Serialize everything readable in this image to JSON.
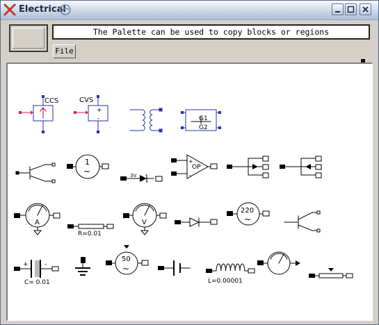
{
  "window": {
    "title": "Electrical"
  },
  "header": {
    "message": "The Palette can be used to copy blocks or regions",
    "file_label": "File"
  },
  "palette": {
    "ccs_label": "CCS",
    "cvs_label": "CVS",
    "cvs_plus": "+",
    "cvs_minus": "-",
    "gyrator_g1": "G1",
    "gyrator_g2": "G2",
    "sine_source_1": "1",
    "sine_symbol": "~",
    "zener_label": "3V",
    "opamp_label": "OP",
    "ammeter_label": "A",
    "resistor_label": "R=0.01",
    "voltmeter_label": "V",
    "ac_source_220": "220",
    "capacitor_plus": "+",
    "capacitor_minus": "-",
    "capacitor_label": "C= 0.01",
    "current_source_50": "50",
    "inductor_label": "L=0.00001"
  }
}
